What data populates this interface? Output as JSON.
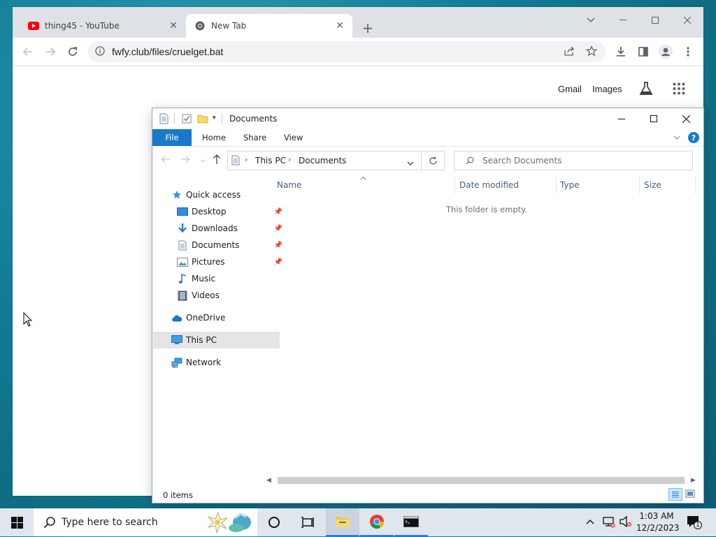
{
  "chrome": {
    "tabs": [
      {
        "title": "thing45 - YouTube",
        "favicon": "youtube-icon"
      },
      {
        "title": "New Tab",
        "favicon": "chrome-icon"
      }
    ],
    "url": "fwfy.club/files/cruelget.bat",
    "links": {
      "gmail": "Gmail",
      "images": "Images"
    }
  },
  "explorer": {
    "title": "Documents",
    "ribbon_tabs": [
      "File",
      "Home",
      "Share",
      "View"
    ],
    "breadcrumb": [
      "This PC",
      "Documents"
    ],
    "search_placeholder": "Search Documents",
    "nav": {
      "quick_access": "Quick access",
      "items": [
        "Desktop",
        "Downloads",
        "Documents",
        "Pictures",
        "Music",
        "Videos"
      ],
      "onedrive": "OneDrive",
      "this_pc": "This PC",
      "network": "Network"
    },
    "columns": [
      "Name",
      "Date modified",
      "Type",
      "Size"
    ],
    "empty_message": "This folder is empty.",
    "status": "0 items"
  },
  "taskbar": {
    "search_placeholder": "Type here to search",
    "time": "1:03 AM",
    "date": "12/2/2023",
    "notification_count": "1"
  },
  "colors": {
    "file_tab": "#1979ca",
    "taskbar": "#dfe6ee",
    "desktop": "#127a93"
  }
}
